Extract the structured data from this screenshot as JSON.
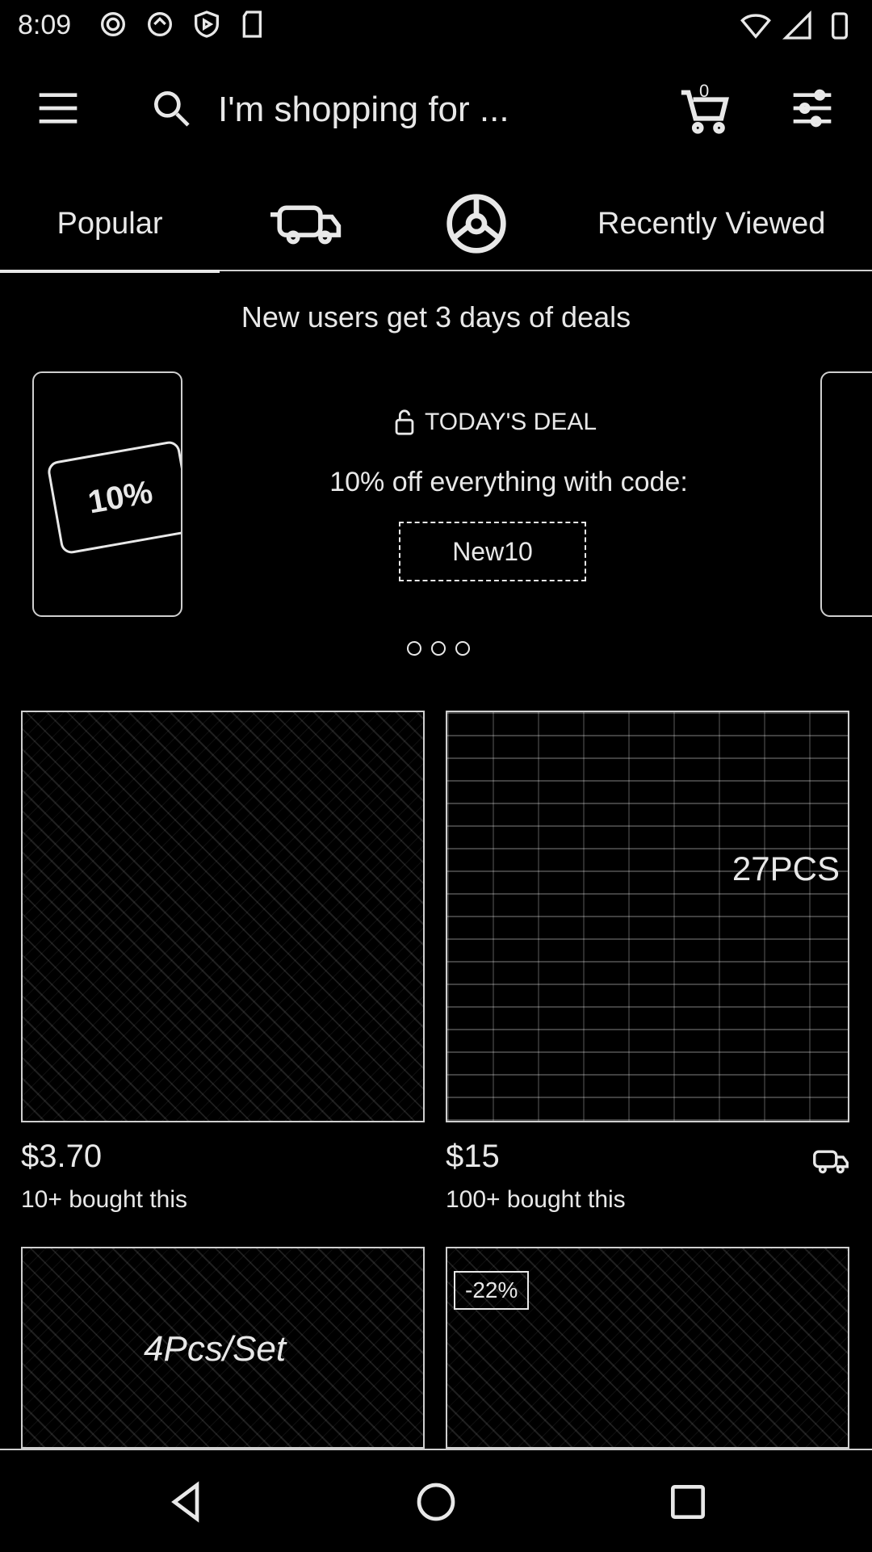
{
  "status": {
    "time": "8:09",
    "icons_left": [
      "gear-icon",
      "refresh-icon",
      "play-shield-icon",
      "sd-card-icon"
    ],
    "icons_right": [
      "wifi-icon",
      "signal-icon",
      "battery-icon"
    ]
  },
  "header": {
    "search_placeholder": "I'm shopping for ...",
    "cart_count": "0"
  },
  "tabs": [
    {
      "label": "Popular",
      "icon": ""
    },
    {
      "label": "",
      "icon": "delivery-truck-icon"
    },
    {
      "label": "",
      "icon": "wheel-icon"
    },
    {
      "label": "Recently Viewed",
      "icon": ""
    }
  ],
  "promo": {
    "title": "New users get 3 days of deals",
    "deal_label": "TODAY'S DEAL",
    "deal_text": "10% off everything with code:",
    "code": "New10",
    "ticket_text": "10%"
  },
  "products": [
    {
      "price": "$3.70",
      "bought": "10+ bought this",
      "tag": ""
    },
    {
      "price": "$15",
      "bought": "100+ bought this",
      "tag": "27PCS",
      "free_shipping": true
    },
    {
      "price": "",
      "bought": "",
      "tag": "",
      "overlay": "4Pcs/Set"
    },
    {
      "price": "",
      "bought": "",
      "tag": "",
      "discount": "-22%"
    }
  ]
}
